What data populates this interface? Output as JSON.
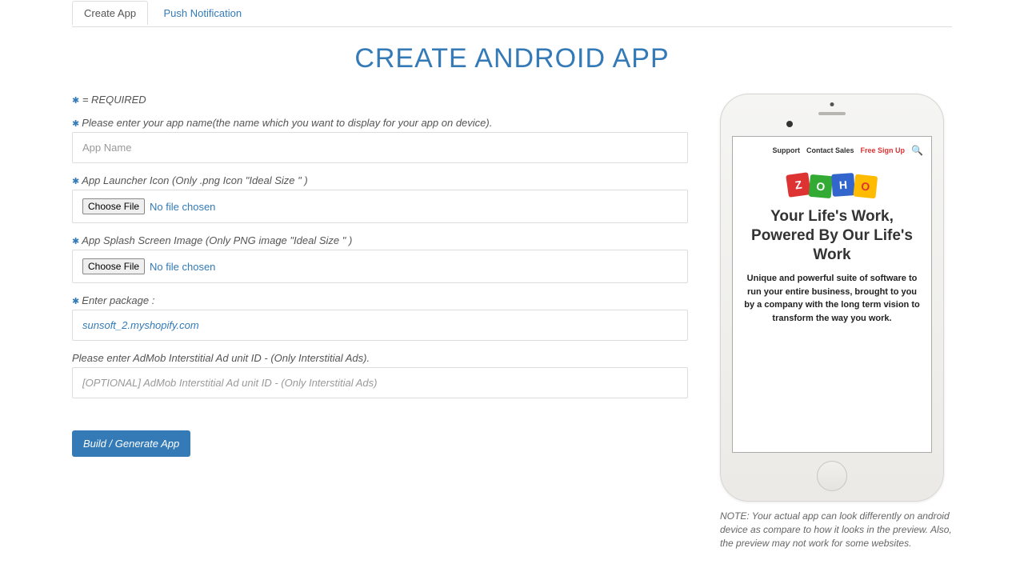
{
  "tabs": {
    "create": "Create App",
    "push": "Push Notification"
  },
  "title": "CREATE ANDROID APP",
  "required_note": "= REQUIRED",
  "labels": {
    "app_name": "Please enter your app name(the name which you want to display for your app on device).",
    "launcher": "App Launcher Icon (Only .png Icon \"Ideal Size \" )",
    "splash": "App Splash Screen Image (Only PNG image \"Ideal Size \" )",
    "package": "Enter package :",
    "admob": "Please enter AdMob Interstitial Ad unit ID - (Only Interstitial Ads)."
  },
  "placeholders": {
    "app_name": "App Name",
    "admob": "[OPTIONAL] AdMob Interstitial Ad unit ID - (Only Interstitial Ads)"
  },
  "file": {
    "btn": "Choose File",
    "none": "No file chosen"
  },
  "package_value": "sunsoft_2.myshopify.com",
  "build_btn": "Build / Generate App",
  "preview": {
    "top": {
      "support": "Support",
      "contact": "Contact Sales",
      "signup": "Free Sign Up"
    },
    "logo": [
      "Z",
      "O",
      "H",
      "O"
    ],
    "headline": "Your Life's Work, Powered By Our Life's Work",
    "sub": "Unique and powerful suite of software to run your entire business, brought to you by a company with the long term vision to transform the way you work."
  },
  "note": "NOTE: Your actual app can look differently on android device as compare to how it looks in the preview. Also, the preview may not work for some websites."
}
